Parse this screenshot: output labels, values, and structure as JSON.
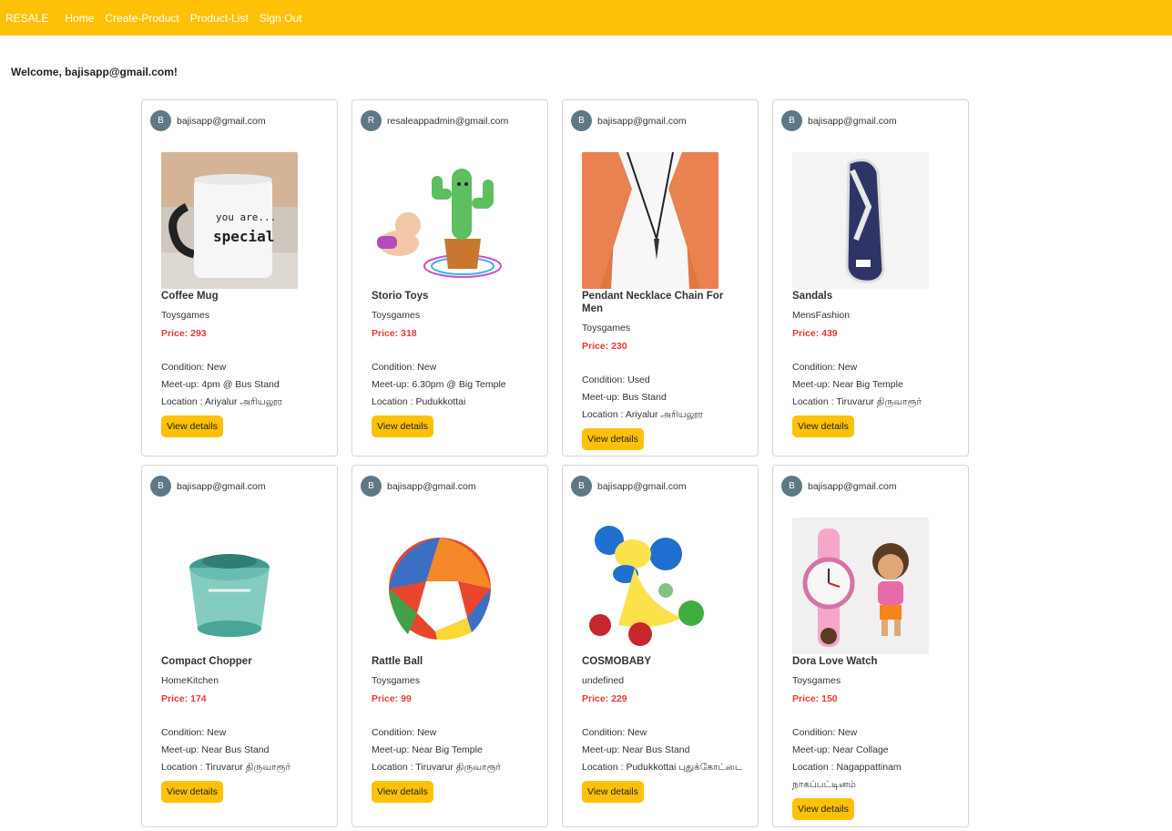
{
  "nav": {
    "brand": "RESALE",
    "links": [
      "Home",
      "Create-Product",
      "Product-List",
      "Sign Out"
    ]
  },
  "welcome": "Welcome, bajisapp@gmail.com!",
  "labels": {
    "price_prefix": "Price: ",
    "condition_prefix": "Condition: ",
    "meetup_prefix": "Meet-up: ",
    "location_prefix": "Location : ",
    "view_details": "View details"
  },
  "products": [
    {
      "avatar": "B",
      "owner": "bajisapp@gmail.com",
      "image_icon": "coffee-mug-image",
      "name": "Coffee Mug",
      "category": "Toysgames",
      "price": "293",
      "condition": "New",
      "meetup": "4pm @ Bus Stand",
      "location": "Ariyalur அரியலூர"
    },
    {
      "avatar": "R",
      "owner": "resaleappadmin@gmail.com",
      "image_icon": "dancing-cactus-toy-image",
      "name": "Storio Toys",
      "category": "Toysgames",
      "price": "318",
      "condition": "New",
      "meetup": "6.30pm @ Big Temple",
      "location": "Pudukkottai"
    },
    {
      "avatar": "B",
      "owner": "bajisapp@gmail.com",
      "image_icon": "pendant-necklace-image",
      "name": "Pendant Necklace Chain For Men",
      "category": "Toysgames",
      "price": "230",
      "condition": "Used",
      "meetup": "Bus Stand",
      "location": "Ariyalur அரியலூர"
    },
    {
      "avatar": "B",
      "owner": "bajisapp@gmail.com",
      "image_icon": "sandal-image",
      "name": "Sandals",
      "category": "MensFashion",
      "price": "439",
      "condition": "New",
      "meetup": "Near Big Temple",
      "location": "Tiruvarur திருவாரூர்"
    },
    {
      "avatar": "B",
      "owner": "bajisapp@gmail.com",
      "image_icon": "vegetable-chopper-image",
      "name": "Compact Chopper",
      "category": "HomeKitchen",
      "price": "174",
      "condition": "New",
      "meetup": "Near Bus Stand",
      "location": "Tiruvarur திருவாரூர்"
    },
    {
      "avatar": "B",
      "owner": "bajisapp@gmail.com",
      "image_icon": "rattle-ball-image",
      "name": "Rattle Ball",
      "category": "Toysgames",
      "price": "99",
      "condition": "New",
      "meetup": "Near Big Temple",
      "location": "Tiruvarur திருவாரூர்"
    },
    {
      "avatar": "B",
      "owner": "bajisapp@gmail.com",
      "image_icon": "toy-dog-image",
      "name": "COSMOBABY",
      "category": "undefined",
      "price": "229",
      "condition": "New",
      "meetup": "Near Bus Stand",
      "location": "Pudukkottai புதுக்கோட்டை"
    },
    {
      "avatar": "B",
      "owner": "bajisapp@gmail.com",
      "image_icon": "dora-watch-image",
      "name": "Dora Love Watch",
      "category": "Toysgames",
      "price": "150",
      "condition": "New",
      "meetup": "Near Collage",
      "location": "Nagappattinam நாகப்பட்டினம்"
    }
  ]
}
